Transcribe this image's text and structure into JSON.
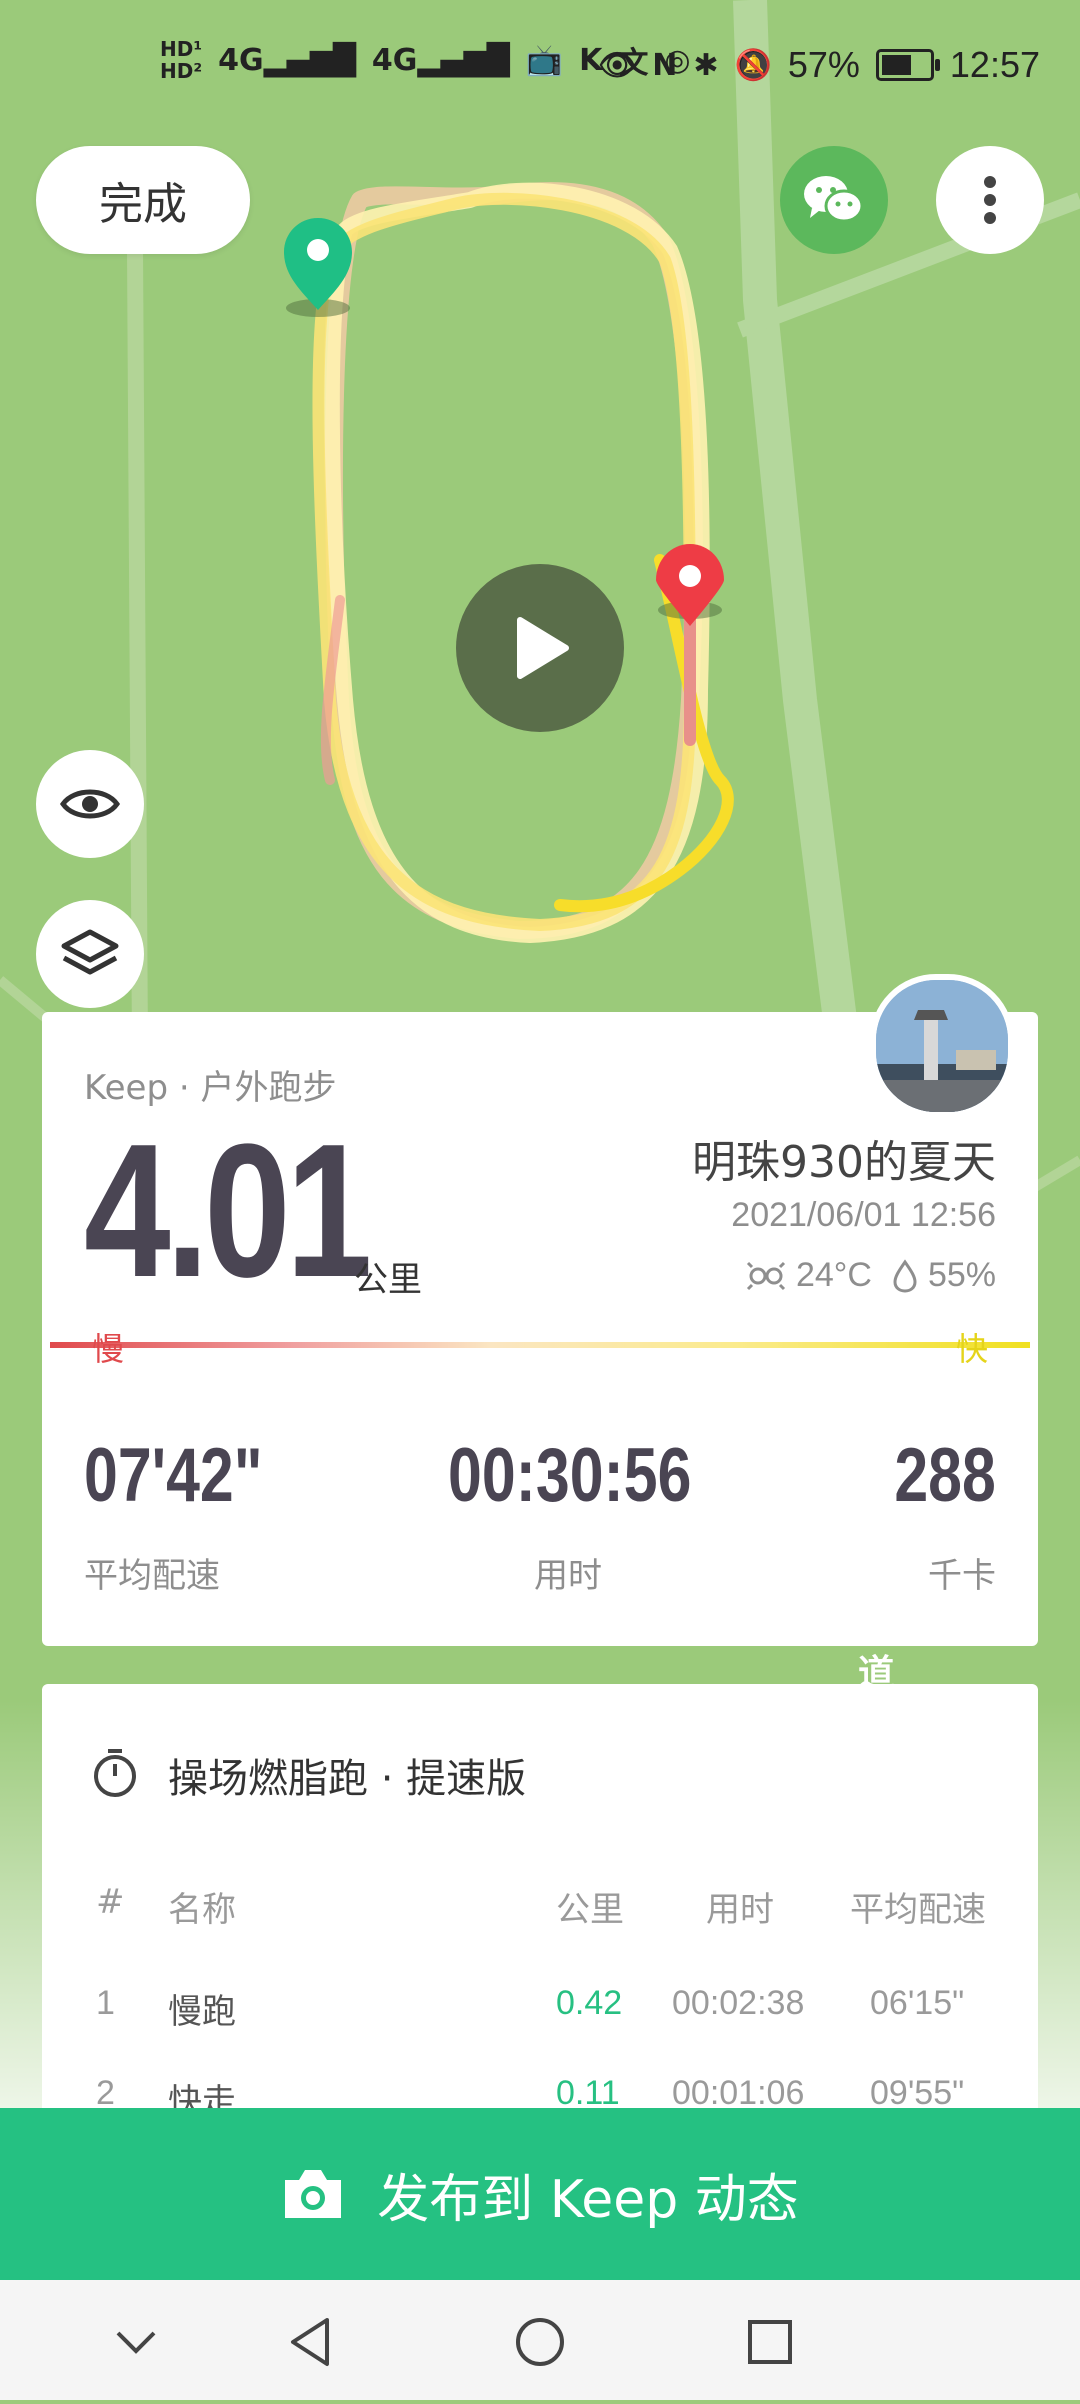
{
  "status_bar": {
    "left_indicators": [
      "HD1",
      "HD2",
      "4G",
      "4G"
    ],
    "battery_percent": "57%",
    "time": "12:57"
  },
  "top_actions": {
    "done_label": "完成"
  },
  "map_overlay": {
    "street_label": "道"
  },
  "summary": {
    "sport_type": "Keep · 户外跑步",
    "distance": "4.01",
    "distance_unit": "公里",
    "user_name": "明珠930的夏天",
    "date_time": "2021/06/01 12:56",
    "temperature": "24°C",
    "humidity": "55%",
    "slow_label": "慢",
    "fast_label": "快",
    "stats": [
      {
        "value": "07'42\"",
        "label": "平均配速"
      },
      {
        "value": "00:30:56",
        "label": "用时"
      },
      {
        "value": "288",
        "label": "千卡"
      }
    ]
  },
  "segments": {
    "title": "操场燃脂跑 · 提速版",
    "headers": [
      "#",
      "名称",
      "公里",
      "用时",
      "平均配速"
    ],
    "rows": [
      {
        "index": "1",
        "name": "慢跑",
        "km": "0.42",
        "time": "00:02:38",
        "pace": "06'15\""
      },
      {
        "index": "2",
        "name": "快走",
        "km": "0.11",
        "time": "00:01:06",
        "pace": "09'55\""
      }
    ]
  },
  "publish_button": {
    "label": "发布到 Keep 动态"
  },
  "colors": {
    "accent_green": "#25c182",
    "map_green": "#9bca7a",
    "text_dark": "#4a4553",
    "slow_red": "#e0494c",
    "fast_yellow": "#e5d41a"
  }
}
